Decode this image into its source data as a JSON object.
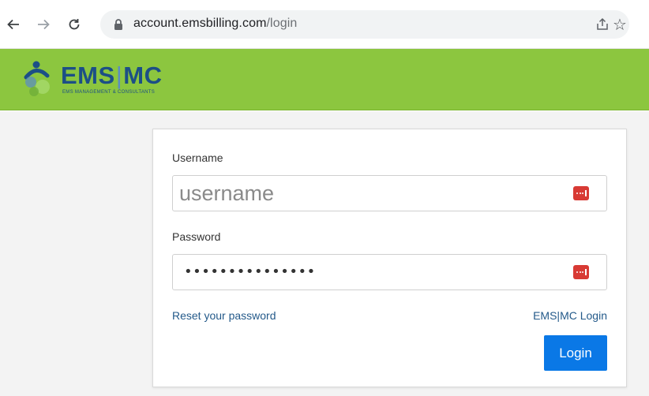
{
  "browser": {
    "url_host": "account.emsbilling.com",
    "url_path": "/login",
    "icons": [
      "back-arrow-icon",
      "forward-arrow-icon",
      "reload-icon",
      "lock-icon",
      "share-icon",
      "star-icon"
    ]
  },
  "header": {
    "logo_main_left": "EMS",
    "logo_separator": "|",
    "logo_main_right": "MC",
    "logo_tagline": "EMS MANAGEMENT & CONSULTANTS",
    "brand_green": "#8cc63f",
    "brand_blue": "#1c4f86"
  },
  "login_form": {
    "username_label": "Username",
    "username_placeholder": "username",
    "password_label": "Password",
    "password_value": "•••••••••••••••",
    "reset_link": "Reset your password",
    "emsmc_link": "EMS|MC Login",
    "login_button": "Login",
    "button_color": "#0a78e6"
  }
}
